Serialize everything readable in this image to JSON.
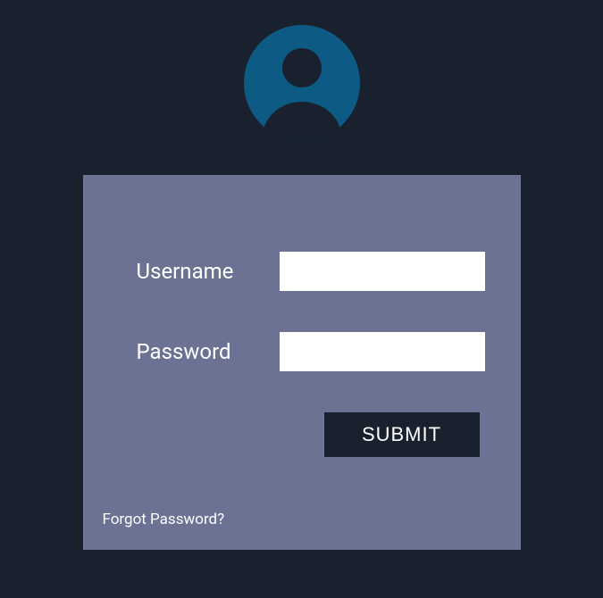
{
  "icon": {
    "name": "user-avatar-icon",
    "bg_color": "#0d5a84",
    "fg_color": "#19212f"
  },
  "panel": {
    "bg_color": "#6c7293"
  },
  "form": {
    "username_label": "Username",
    "username_value": "",
    "password_label": "Password",
    "password_value": "",
    "submit_label": "SUBMIT"
  },
  "links": {
    "forgot_password": "Forgot Password?"
  },
  "colors": {
    "page_bg": "#19212f",
    "input_bg": "#ffffff",
    "button_bg": "#19212f",
    "text": "#ffffff"
  }
}
